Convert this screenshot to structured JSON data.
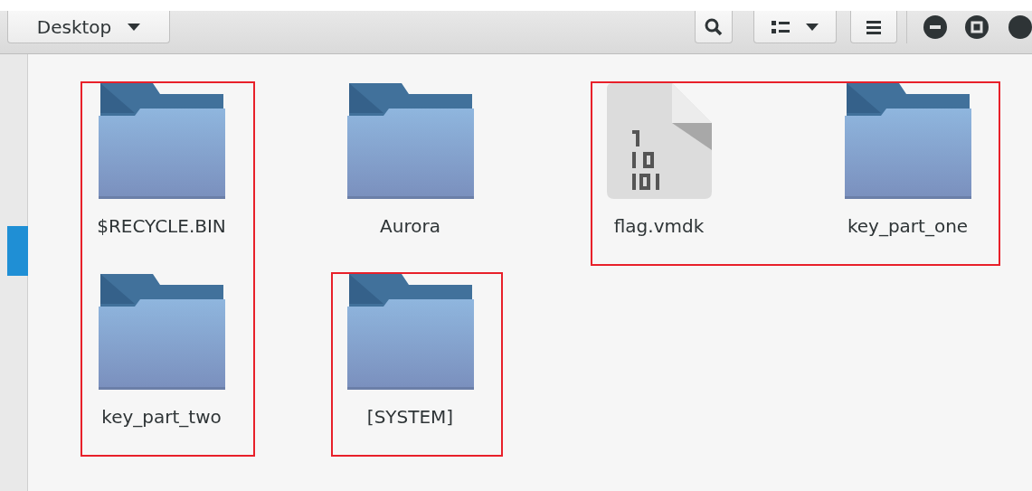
{
  "location": {
    "label": "Desktop"
  },
  "items": [
    {
      "name": "$RECYCLE.BIN",
      "kind": "folder",
      "framed": true,
      "frame_joins_below": true
    },
    {
      "name": "Aurora",
      "kind": "folder",
      "framed": false
    },
    {
      "name": "flag.vmdk",
      "kind": "binary",
      "framed": true,
      "frame_joins_right": true
    },
    {
      "name": "key_part_one",
      "kind": "folder",
      "framed": true
    },
    {
      "name": "key_part_two",
      "kind": "folder",
      "framed": true
    },
    {
      "name": "[SYSTEM]",
      "kind": "folder",
      "framed": true
    }
  ]
}
